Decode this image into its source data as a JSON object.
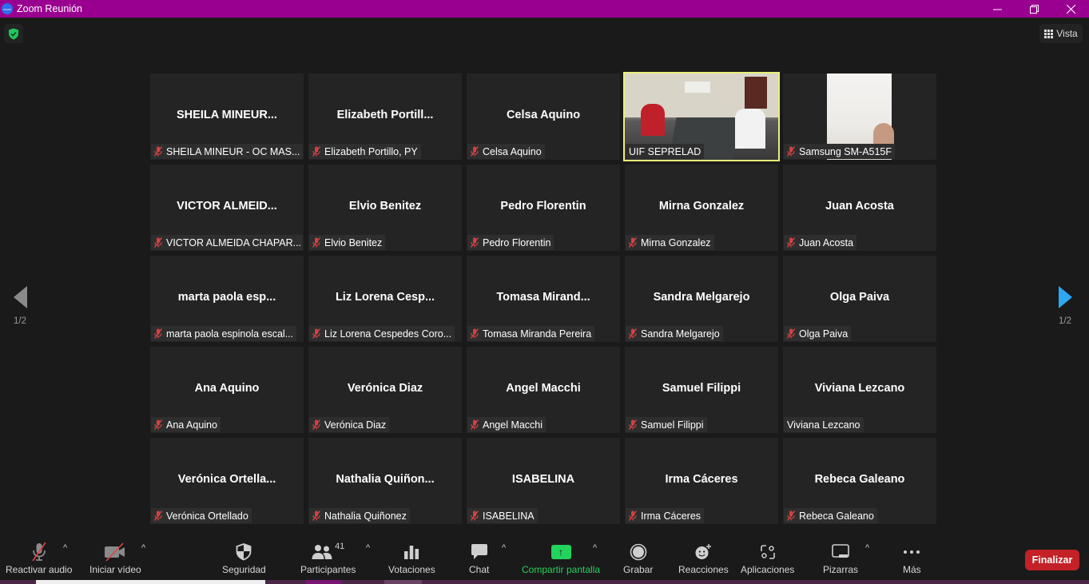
{
  "window": {
    "title": "Zoom Reunión",
    "logo_text": "zoom",
    "minimize_icon": "minimize-icon",
    "restore_icon": "restore-icon",
    "close_icon": "close-icon"
  },
  "top_bar": {
    "security_status_icon": "shield-check-icon",
    "view_button_label": "Vista",
    "view_icon": "grid-icon"
  },
  "pagination": {
    "left_label": "1/2",
    "right_label": "1/2",
    "prev_icon": "triangle-left-icon",
    "next_icon": "triangle-right-icon"
  },
  "colors": {
    "titlebar": "#9a0090",
    "active_speaker_border": "#e8f07a",
    "share_green": "#22d35c",
    "end_red": "#c32127",
    "next_arrow": "#2ea7f2",
    "muted_mic": "#e04444"
  },
  "participants": [
    {
      "display": "SHEILA  MINEUR...",
      "tag": "SHEILA MINEUR - OC MAS...",
      "muted": true,
      "video": false
    },
    {
      "display": "Elizabeth  Portill...",
      "tag": "Elizabeth Portillo, PY",
      "muted": true,
      "video": false
    },
    {
      "display": "Celsa Aquino",
      "tag": "Celsa Aquino",
      "muted": true,
      "video": false
    },
    {
      "display": "",
      "tag": "UIF SEPRELAD",
      "muted": false,
      "video": true,
      "active_speaker": true
    },
    {
      "display": "",
      "tag": "Samsung SM-A515F",
      "muted": true,
      "video": true
    },
    {
      "display": "VICTOR  ALMEID...",
      "tag": "VICTOR ALMEIDA CHAPAR...",
      "muted": true,
      "video": false
    },
    {
      "display": "Elvio Benitez",
      "tag": "Elvio Benitez",
      "muted": true,
      "video": false
    },
    {
      "display": "Pedro Florentin",
      "tag": "Pedro Florentin",
      "muted": true,
      "video": false
    },
    {
      "display": "Mirna Gonzalez",
      "tag": "Mirna Gonzalez",
      "muted": true,
      "video": false
    },
    {
      "display": "Juan Acosta",
      "tag": "Juan Acosta",
      "muted": true,
      "video": false
    },
    {
      "display": "marta  paola  esp...",
      "tag": "marta paola espinola escal...",
      "muted": true,
      "video": false
    },
    {
      "display": "Liz  Lorena  Cesp...",
      "tag": "Liz Lorena Cespedes Coro...",
      "muted": true,
      "video": false
    },
    {
      "display": "Tomasa  Mirand...",
      "tag": "Tomasa Miranda Pereira",
      "muted": true,
      "video": false
    },
    {
      "display": "Sandra Melgarejo",
      "tag": "Sandra Melgarejo",
      "muted": true,
      "video": false
    },
    {
      "display": "Olga Paiva",
      "tag": "Olga Paiva",
      "muted": true,
      "video": false
    },
    {
      "display": "Ana Aquino",
      "tag": "Ana Aquino",
      "muted": true,
      "video": false
    },
    {
      "display": "Verónica Diaz",
      "tag": "Verónica Diaz",
      "muted": true,
      "video": false
    },
    {
      "display": "Angel Macchi",
      "tag": "Angel Macchi",
      "muted": true,
      "video": false
    },
    {
      "display": "Samuel Filippi",
      "tag": "Samuel Filippi",
      "muted": true,
      "video": false
    },
    {
      "display": "Viviana Lezcano",
      "tag": "Viviana Lezcano",
      "muted": false,
      "video": false
    },
    {
      "display": "Verónica  Ortella...",
      "tag": "Verónica Ortellado",
      "muted": true,
      "video": false
    },
    {
      "display": "Nathalia  Quiñon...",
      "tag": "Nathalia Quiñonez",
      "muted": true,
      "video": false
    },
    {
      "display": "ISABELINA",
      "tag": "ISABELINA",
      "muted": true,
      "video": false
    },
    {
      "display": "Irma Cáceres",
      "tag": "Irma Cáceres",
      "muted": true,
      "video": false
    },
    {
      "display": "Rebeca Galeano",
      "tag": "Rebeca Galeano",
      "muted": true,
      "video": false
    }
  ],
  "toolbar": {
    "audio": {
      "label": "Reactivar audio",
      "icon": "mic-muted-icon"
    },
    "video": {
      "label": "Iniciar vídeo",
      "icon": "camera-off-icon"
    },
    "security": {
      "label": "Seguridad",
      "icon": "shield-icon"
    },
    "participants": {
      "label": "Participantes",
      "count": "41",
      "icon": "people-icon"
    },
    "polls": {
      "label": "Votaciones",
      "icon": "bar-chart-icon"
    },
    "chat": {
      "label": "Chat",
      "icon": "chat-bubble-icon"
    },
    "share": {
      "label": "Compartir pantalla",
      "icon": "share-screen-icon"
    },
    "record": {
      "label": "Grabar",
      "icon": "record-icon"
    },
    "reactions": {
      "label": "Reacciones",
      "icon": "emoji-plus-icon"
    },
    "apps": {
      "label": "Aplicaciones",
      "icon": "apps-icon"
    },
    "whiteboards": {
      "label": "Pizarras",
      "icon": "whiteboard-icon"
    },
    "more": {
      "label": "Más",
      "icon": "more-dots-icon"
    },
    "caret": "^",
    "end_label": "Finalizar"
  }
}
